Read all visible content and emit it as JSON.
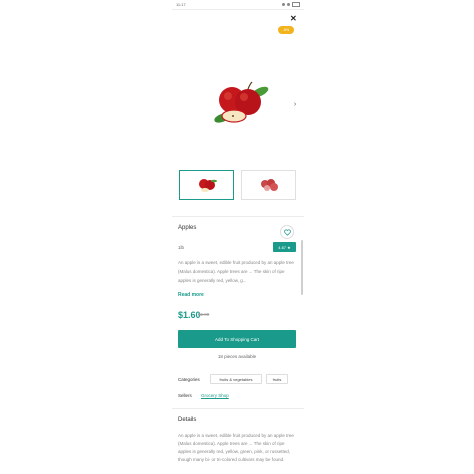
{
  "status_bar": {
    "time": "11:17"
  },
  "discount_badge": "-5%",
  "product": {
    "name": "Apples",
    "unit": "1lb",
    "rating": "4.67 ★",
    "description_short": "An apple is a sweet, edible fruit produced by an apple tree (Malus domestica). Apple trees are ... The skin of ripe apples is generally red, yellow, g...",
    "read_more": "Read more",
    "price": "$1.60",
    "old_price": "$2.00",
    "add_to_cart": "Add To Shopping Cart",
    "availability": "18 pieces available",
    "categories_label": "Categories",
    "categories": [
      "fruits & vegetables",
      "fruits"
    ],
    "sellers_label": "Sellers",
    "seller": "Grocery Shop",
    "details_title": "Details",
    "details_text": "An apple is a sweet, edible fruit produced by an apple tree (Malus domestica). Apple trees are ... The skin of ripe apples is generally red, yellow, green, pink, or russetted, though many bi- or tri-colored cultivars may be found."
  },
  "colors": {
    "accent": "#1a9a8a",
    "badge": "#f2b31d"
  },
  "icons": {
    "close": "close-icon",
    "next": "chevron-right-icon",
    "wishlist": "heart-icon"
  }
}
